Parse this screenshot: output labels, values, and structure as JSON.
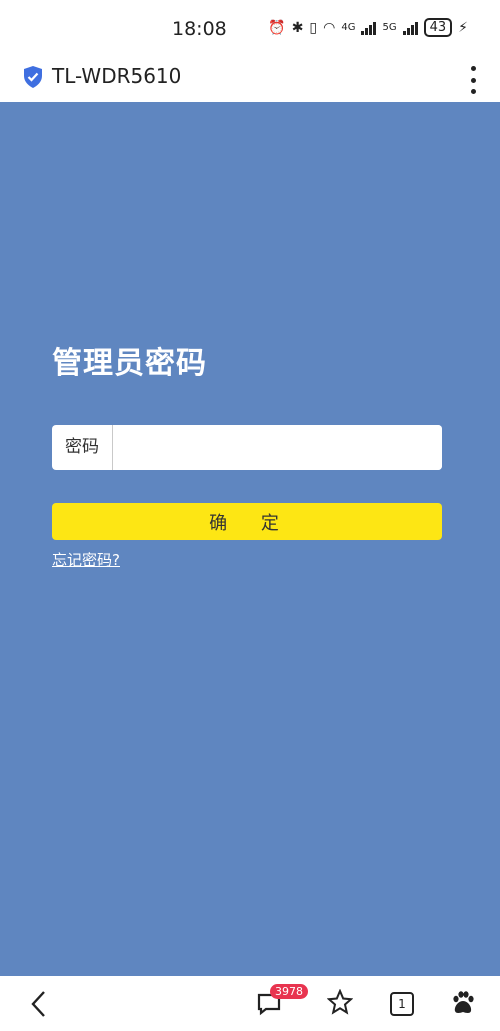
{
  "status_bar": {
    "time": "18:08",
    "network_4g": "4G",
    "network_5g": "5G",
    "battery": "43"
  },
  "url_bar": {
    "title": "TL-WDR5610"
  },
  "login": {
    "heading": "管理员密码",
    "password_label": "密码",
    "password_value": "",
    "confirm_label": "确 定",
    "forgot_link": "忘记密码?"
  },
  "bottom_nav": {
    "comment_badge": "3978",
    "tab_count": "1"
  },
  "colors": {
    "background": "#5f86c0",
    "confirm_button": "#fde614",
    "badge": "#e8344f",
    "shield": "#3f6fe0"
  }
}
